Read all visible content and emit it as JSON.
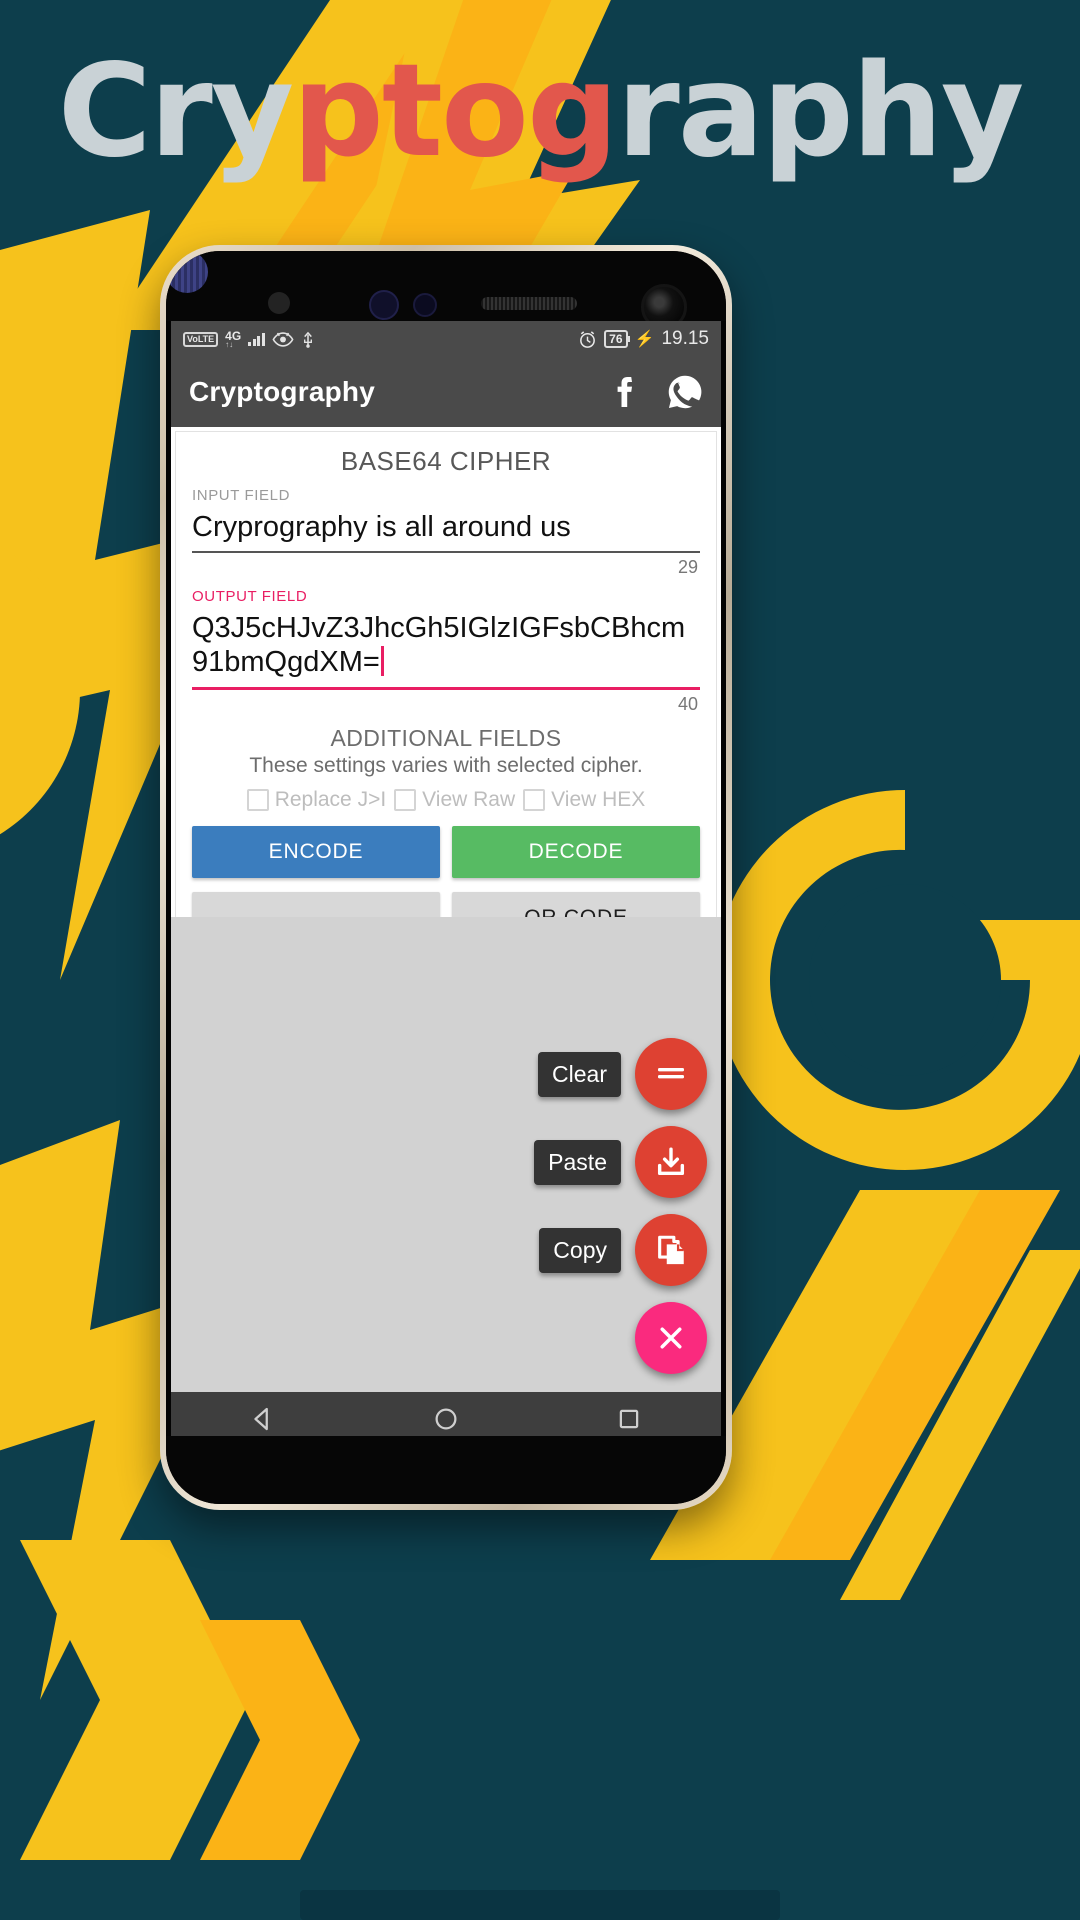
{
  "poster": {
    "headline_parts": [
      {
        "text": "Cry",
        "color": "#c9d2d6"
      },
      {
        "text": "ptog",
        "color": "#e2574c"
      },
      {
        "text": "raphy",
        "color": "#c9d2d6"
      }
    ],
    "background_color": "#0d3e4c",
    "accent_yellow": "#f5c518",
    "accent_orange": "#f59a0f"
  },
  "statusbar": {
    "volte": "VoLTE",
    "network": "4G",
    "signal_sub": "↑↓",
    "eye_icon": "eye-icon",
    "usb_icon": "usb-icon",
    "alarm_icon": "alarm-icon",
    "battery_level": "76",
    "charging_icon": "charging-bolt-icon",
    "time": "19.15"
  },
  "appbar": {
    "title": "Cryptography",
    "facebook_icon": "facebook-icon",
    "whatsapp_icon": "whatsapp-icon"
  },
  "card": {
    "cipher_title": "BASE64 CIPHER",
    "input_label": "INPUT FIELD",
    "input_value": "Cryprography is all around us",
    "input_counter": "29",
    "output_label": "OUTPUT FIELD",
    "output_value": "Q3J5cHJvZ3JhcGh5IGlzIGFsbCBhcm91bmQgdXM=",
    "output_counter": "40",
    "additional_title": "ADDITIONAL FIELDS",
    "additional_subtitle": "These settings varies with selected cipher.",
    "checkboxes": [
      {
        "label": "Replace J>I",
        "checked": false
      },
      {
        "label": "View Raw",
        "checked": false
      },
      {
        "label": "View HEX",
        "checked": false
      }
    ],
    "buttons": {
      "encode": "ENCODE",
      "decode": "DECODE",
      "empty": "-",
      "qrcode": "QR CODE"
    },
    "colors": {
      "encode": "#3b7dbe",
      "decode": "#57bb63",
      "grey": "#d8d8d8",
      "pink": "#e91e63"
    }
  },
  "fab_menu": {
    "items": [
      {
        "label": "Clear",
        "icon": "lines-icon",
        "color": "#de4132"
      },
      {
        "label": "Paste",
        "icon": "download-icon",
        "color": "#de4132"
      },
      {
        "label": "Copy",
        "icon": "copy-icon",
        "color": "#de4132"
      }
    ],
    "close": {
      "icon": "close-icon",
      "color": "#fa2a7e"
    }
  },
  "navbar": {
    "back_icon": "back-triangle-icon",
    "home_icon": "home-circle-icon",
    "recents_icon": "recents-square-icon"
  }
}
